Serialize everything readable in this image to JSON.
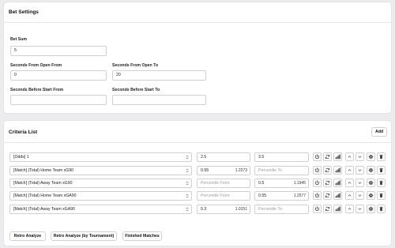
{
  "bet_settings": {
    "title": "Bet Settings",
    "bet_sum": {
      "label": "Bet Sum",
      "value": "5"
    },
    "seconds_from_open_from": {
      "label": "Seconds From Open From",
      "value": "0"
    },
    "seconds_from_open_to": {
      "label": "Seconds From Open To",
      "value": "20"
    },
    "seconds_before_start_from": {
      "label": "Seconds Before Start From",
      "value": ""
    },
    "seconds_before_start_to": {
      "label": "Seconds Before Start To",
      "value": ""
    }
  },
  "criteria": {
    "title": "Criteria List",
    "add_label": "Add",
    "from_placeholder": "Percentile From",
    "to_placeholder": "Percentile To",
    "rows": [
      {
        "criterion": "[Odds] 1",
        "from": "2.5",
        "from_pct": "",
        "to": "3.5",
        "to_pct": ""
      },
      {
        "criterion": "[Match] (Total) Home Team xG90",
        "from": "0.55",
        "from_pct": "1.2273",
        "to": "",
        "to_pct": ""
      },
      {
        "criterion": "[Match] (Total) Away Team xG90",
        "from": "",
        "from_pct": "",
        "to": "0.5",
        "to_pct": "1.1945"
      },
      {
        "criterion": "[Match] (Total) Home Team xGA90",
        "from": "",
        "from_pct": "",
        "to": "0.55",
        "to_pct": "1.2577"
      },
      {
        "criterion": "[Match] (Total) Away Team xGA90",
        "from": "0.3",
        "from_pct": "1.0151",
        "to": "",
        "to_pct": ""
      }
    ]
  },
  "footer": {
    "retro_analyze": "Retro Analyze",
    "retro_analyze_tournament": "Retro Analyze (by Tournament)",
    "finished_matches": "Finished Matches"
  },
  "icons": [
    "power-icon",
    "refresh-icon",
    "bar-chart-icon",
    "chevron-up-icon",
    "chevron-down-icon",
    "gear-icon",
    "trash-icon",
    "sort-icon"
  ]
}
